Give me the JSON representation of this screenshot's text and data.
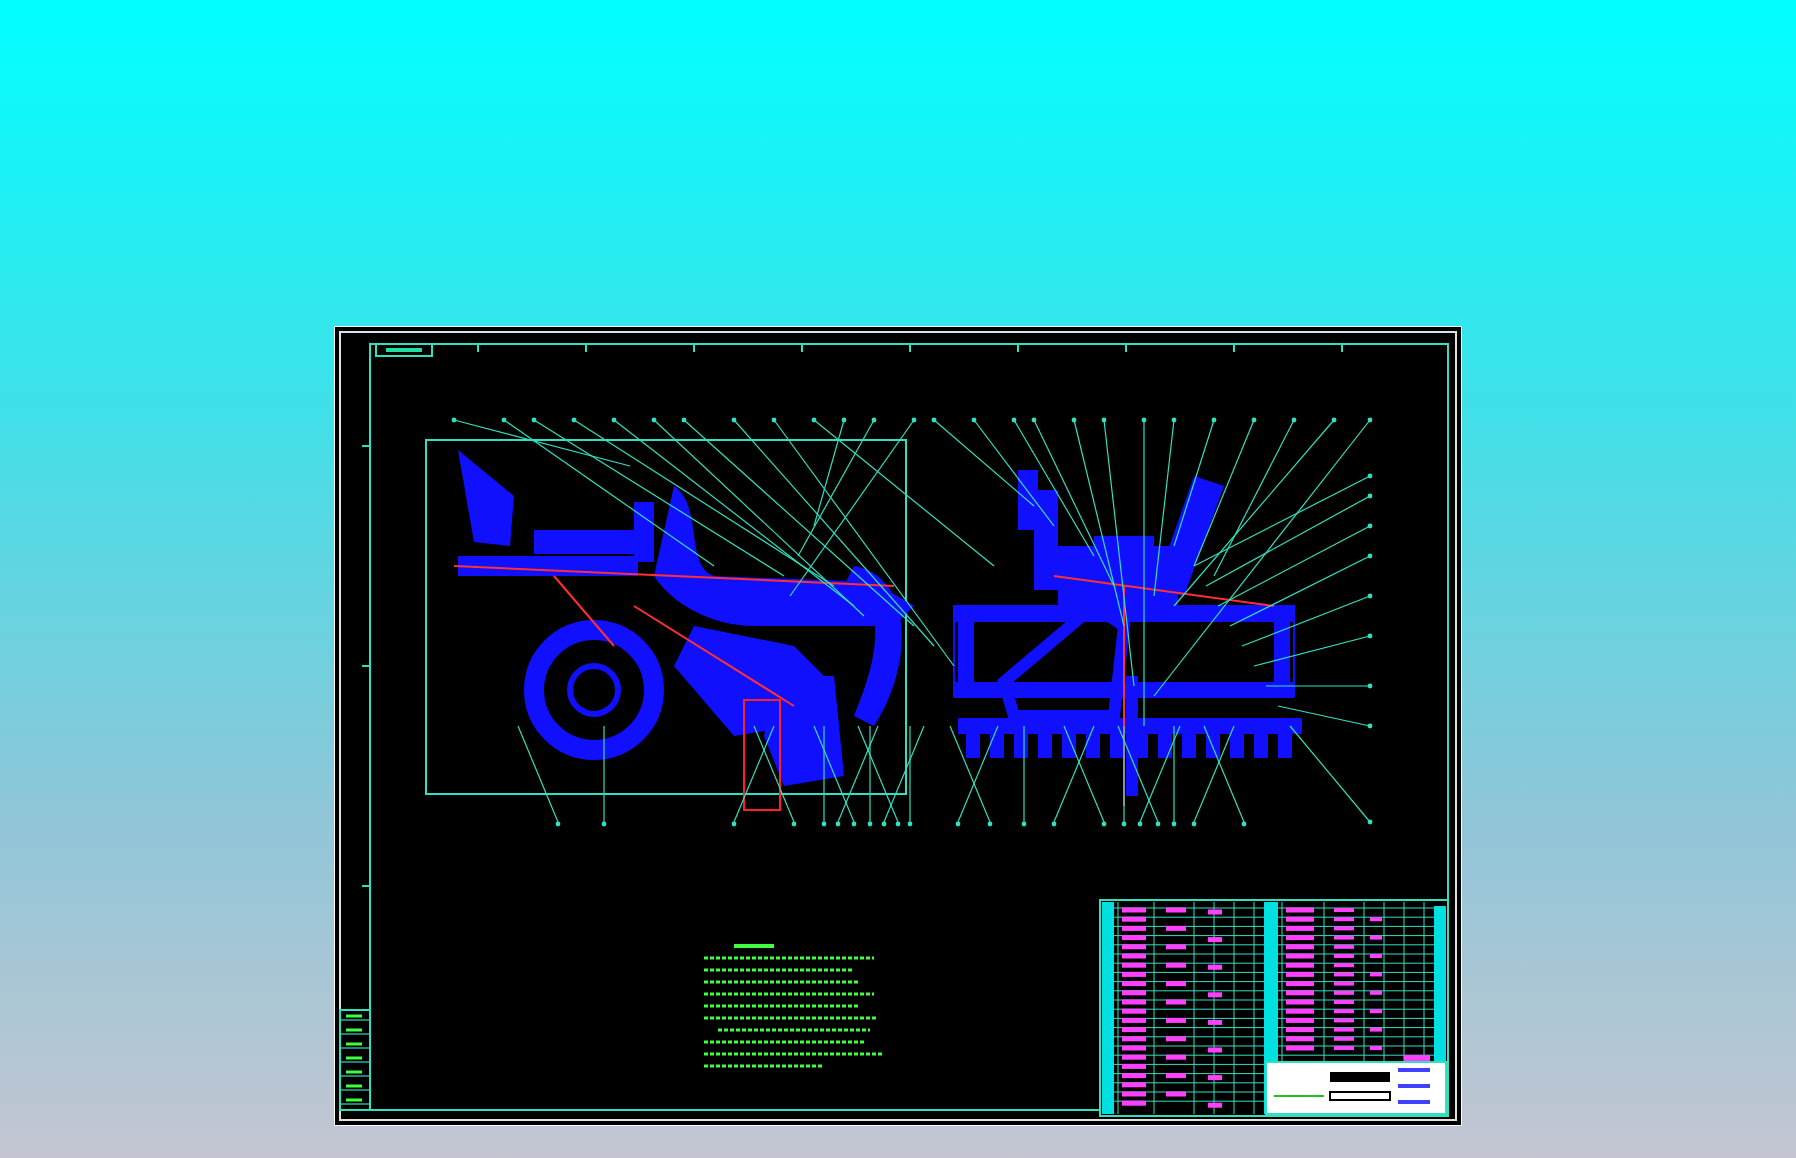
{
  "cad_sheet": {
    "kind": "assembly-drawing"
  }
}
